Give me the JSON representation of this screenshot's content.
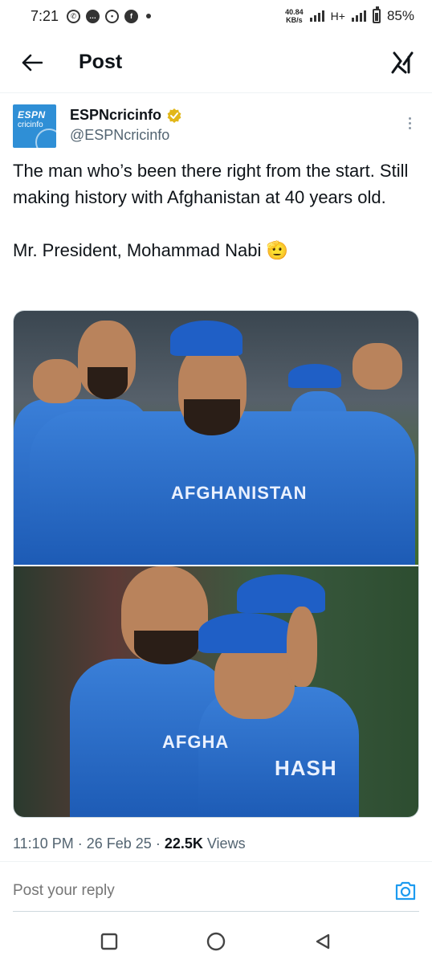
{
  "status_bar": {
    "time": "7:21",
    "speed_value": "40.84",
    "speed_unit": "KB/s",
    "network": "H+",
    "battery": "85%"
  },
  "header": {
    "title": "Post"
  },
  "tweet": {
    "author_name": "ESPNcricinfo",
    "handle": "@ESPNcricinfo",
    "avatar_text": {
      "line1": "ESPN",
      "line2": "cricinfo"
    },
    "paragraphs": [
      "The man who’s been there right from the start. Still making history with Afghanistan at 40 years old.",
      "Mr. President, Mohammad Nabi 🫡"
    ],
    "jersey_text_top": "AFGHANISTAN",
    "jersey_text_bottom_left": "AFGHA",
    "jersey_text_bottom_right": "HASH",
    "time": "11:10 PM",
    "date": "26 Feb 25",
    "views_count": "22.5K",
    "views_label": "Views"
  },
  "reply": {
    "placeholder": "Post your reply"
  },
  "colors": {
    "text": "#0f1419",
    "muted": "#536471",
    "accent": "#1d9bf0",
    "verified": "#e2b719"
  }
}
